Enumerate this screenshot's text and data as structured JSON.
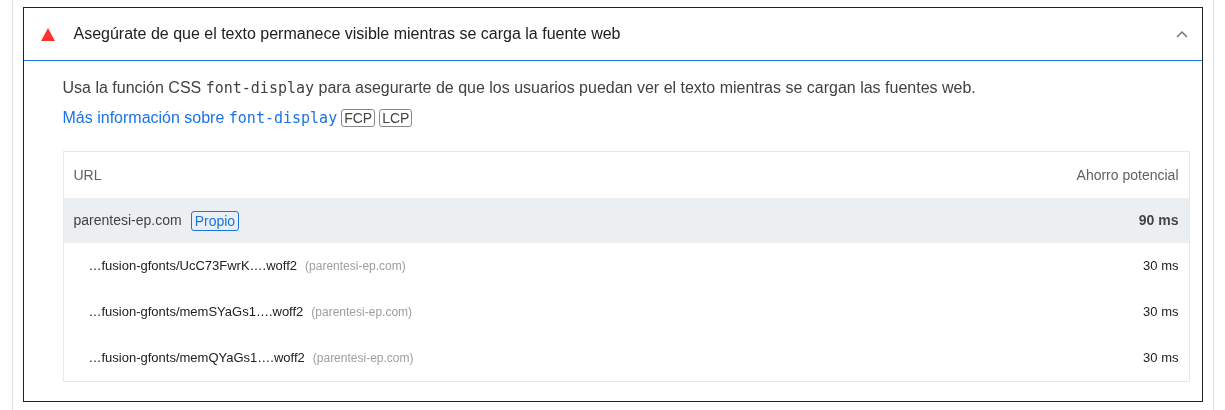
{
  "audit": {
    "kind": "fail",
    "title": "Asegúrate de que el texto permanece visible mientras se carga la fuente web",
    "expanded": true,
    "description": [
      {
        "kind": "text",
        "text": "Usa la función CSS "
      },
      {
        "kind": "code",
        "text": "font-display"
      },
      {
        "kind": "text",
        "text": " para asegurarte de que los usuarios puedan ver el texto mientras se cargan las fuentes web. "
      }
    ],
    "link": [
      {
        "kind": "text",
        "text": "Más información sobre "
      },
      {
        "kind": "code",
        "text": "font-display"
      }
    ],
    "tags": [
      "FCP",
      "LCP"
    ],
    "table": {
      "columns": [
        "URL",
        "Ahorro potencial"
      ],
      "groups": [
        {
          "entity": "parentesi-ep.com",
          "badge": "Propio",
          "saving": "90 ms",
          "items": [
            {
              "url": "…fusion-gfonts/UcC73FwrK….woff2",
              "host": "(parentesi-ep.com)",
              "saving": "30 ms"
            },
            {
              "url": "…fusion-gfonts/memSYaGs1….woff2",
              "host": "(parentesi-ep.com)",
              "saving": "30 ms"
            },
            {
              "url": "…fusion-gfonts/memQYaGs1….woff2",
              "host": "(parentesi-ep.com)",
              "saving": "30 ms"
            }
          ]
        }
      ]
    }
  }
}
